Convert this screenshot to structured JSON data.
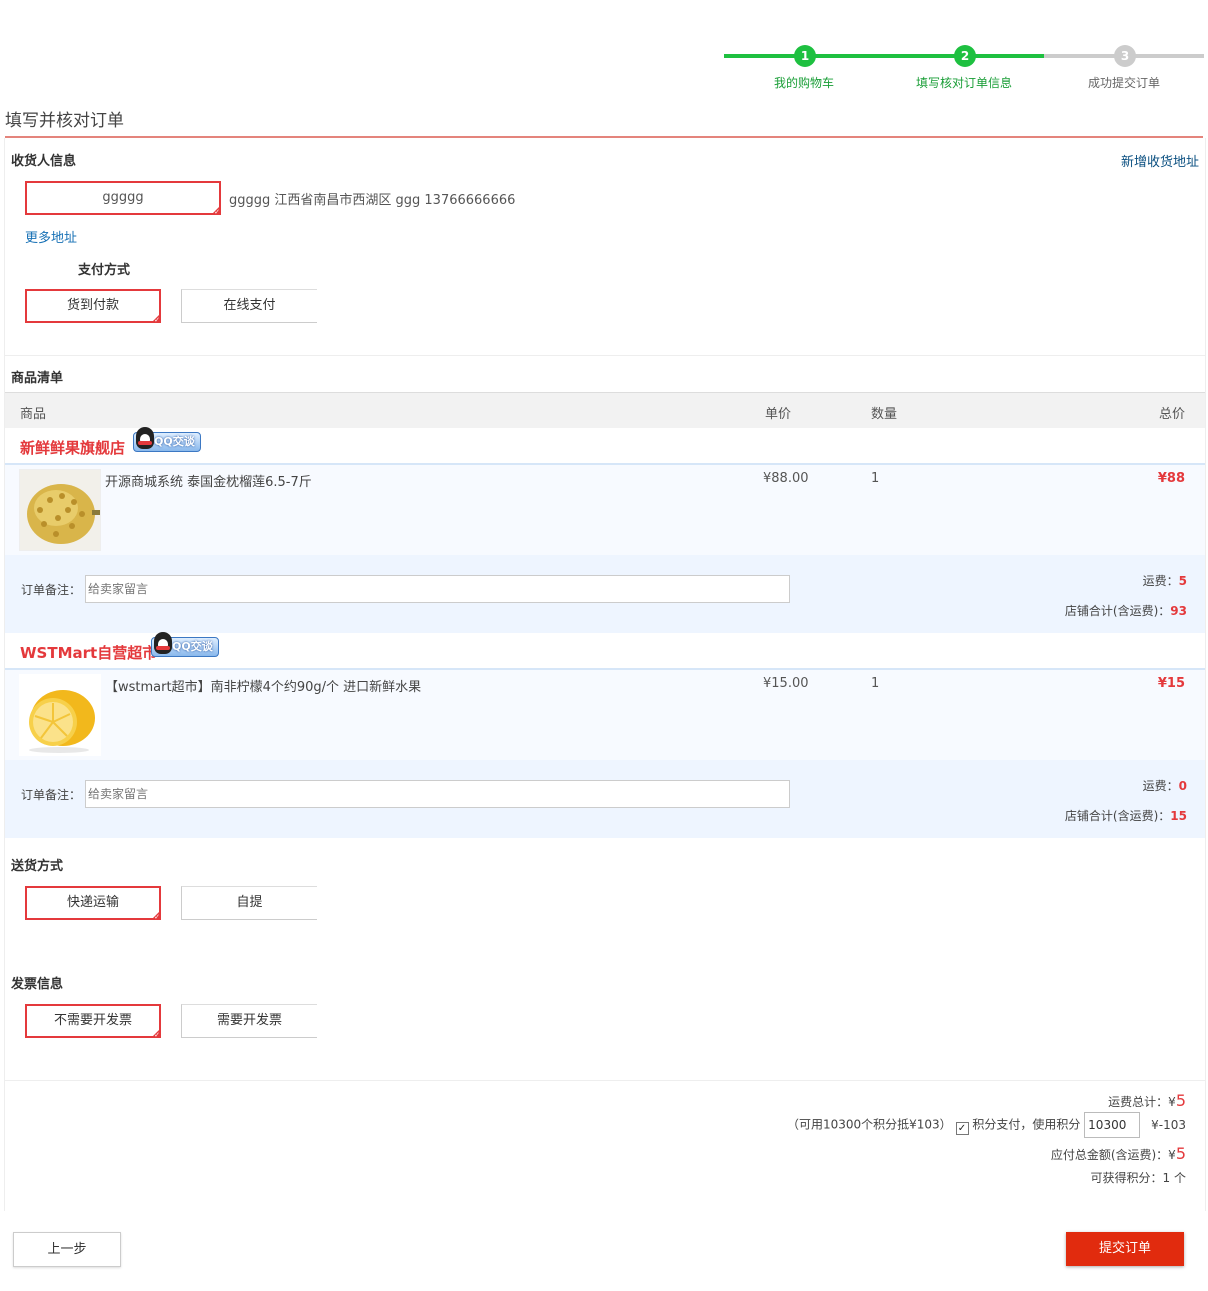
{
  "steps": [
    {
      "num": "1",
      "label": "我的购物车"
    },
    {
      "num": "2",
      "label": "填写核对订单信息"
    },
    {
      "num": "3",
      "label": "成功提交订单"
    }
  ],
  "page_title": "填写并核对订单",
  "consignee": {
    "section_label": "收货人信息",
    "add_address_link": "新增收货地址",
    "selected_name": "ggggg",
    "address_line": "ggggg   江西省南昌市西湖区  ggg  13766666666",
    "more_address_link": "更多地址"
  },
  "payment": {
    "section_label": "支付方式",
    "options": [
      "货到付款",
      "在线支付"
    ]
  },
  "goods_list": {
    "section_label": "商品清单",
    "headers": [
      "商品",
      "单价",
      "数量",
      "总价"
    ],
    "qq_badge": "QQ交谈",
    "shops": [
      {
        "name": "新鲜鲜果旗舰店",
        "product": "开源商城系统 泰国金枕榴莲6.5-7斤",
        "price": "¥88.00",
        "qty": "1",
        "total": "¥88",
        "remark_label": "订单备注：",
        "remark_placeholder": "给卖家留言",
        "shipping_label": "运费：",
        "shipping": "5",
        "subtotal_label": "店铺合计(含运费)：",
        "subtotal": "93"
      },
      {
        "name": "WSTMart自营超市",
        "product": "【wstmart超市】南非柠檬4个约90g/个 进口新鲜水果",
        "price": "¥15.00",
        "qty": "1",
        "total": "¥15",
        "remark_label": "订单备注：",
        "remark_placeholder": "给卖家留言",
        "shipping_label": "运费：",
        "shipping": "0",
        "subtotal_label": "店铺合计(含运费)：",
        "subtotal": "15"
      }
    ]
  },
  "delivery": {
    "section_label": "送货方式",
    "options": [
      "快递运输",
      "自提"
    ]
  },
  "invoice": {
    "section_label": "发票信息",
    "options": [
      "不需要开发票",
      "需要开发票"
    ]
  },
  "summary": {
    "shipping_total_label": "运费总计：¥",
    "shipping_total": "5",
    "points_hint": "（可用10300个积分抵¥103）",
    "points_pay_label": "积分支付，使用积分",
    "points_value": "10300",
    "points_deduct": "¥-103",
    "payable_label": "应付总金额(含运费)：¥",
    "payable": "5",
    "earn_points_label": "可获得积分：",
    "earn_points": "1",
    "earn_points_unit": "个"
  },
  "buttons": {
    "prev": "上一步",
    "submit": "提交订单"
  },
  "colors": {
    "accent_red": "#e4393c",
    "step_green": "#1ec040",
    "submit_bg": "#e12b0e"
  }
}
